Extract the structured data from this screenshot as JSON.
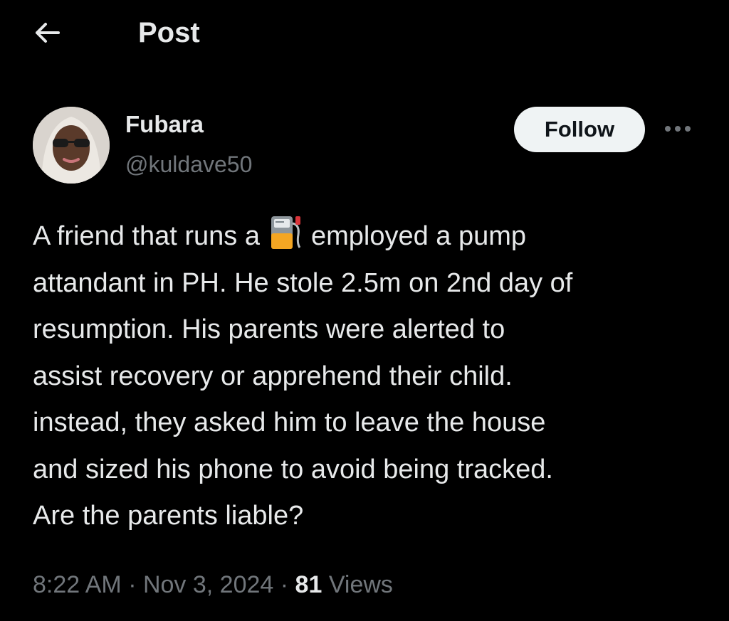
{
  "header": {
    "title": "Post",
    "back_icon": "arrow-left-icon"
  },
  "author": {
    "name": "Fubara",
    "handle": "@kuldave50",
    "avatar_icon": "user-avatar"
  },
  "actions": {
    "follow_label": "Follow",
    "more_icon": "more-horizontal-icon"
  },
  "post": {
    "line1_before": "A friend that runs a",
    "line1_emoji": "fuel-pump-icon",
    "line1_after": "employed  a pump",
    "line2": "attandant in PH. He stole 2.5m on 2nd day of",
    "line3": "resumption. His parents were alerted to",
    "line4": "assist recovery or apprehend their child.",
    "line5": "instead, they asked him to leave the house",
    "line6": "and sized his phone to avoid being tracked.",
    "line7": "Are the parents liable?"
  },
  "meta": {
    "time": "8:22 AM",
    "separator1": " · ",
    "date": "Nov 3, 2024",
    "separator2": " · ",
    "views_count": "81",
    "views_label": " Views"
  },
  "colors": {
    "background": "#000000",
    "primary_text": "#e7e9ea",
    "secondary_text": "#71767b",
    "follow_bg": "#eff3f4",
    "follow_text": "#0f1419"
  }
}
